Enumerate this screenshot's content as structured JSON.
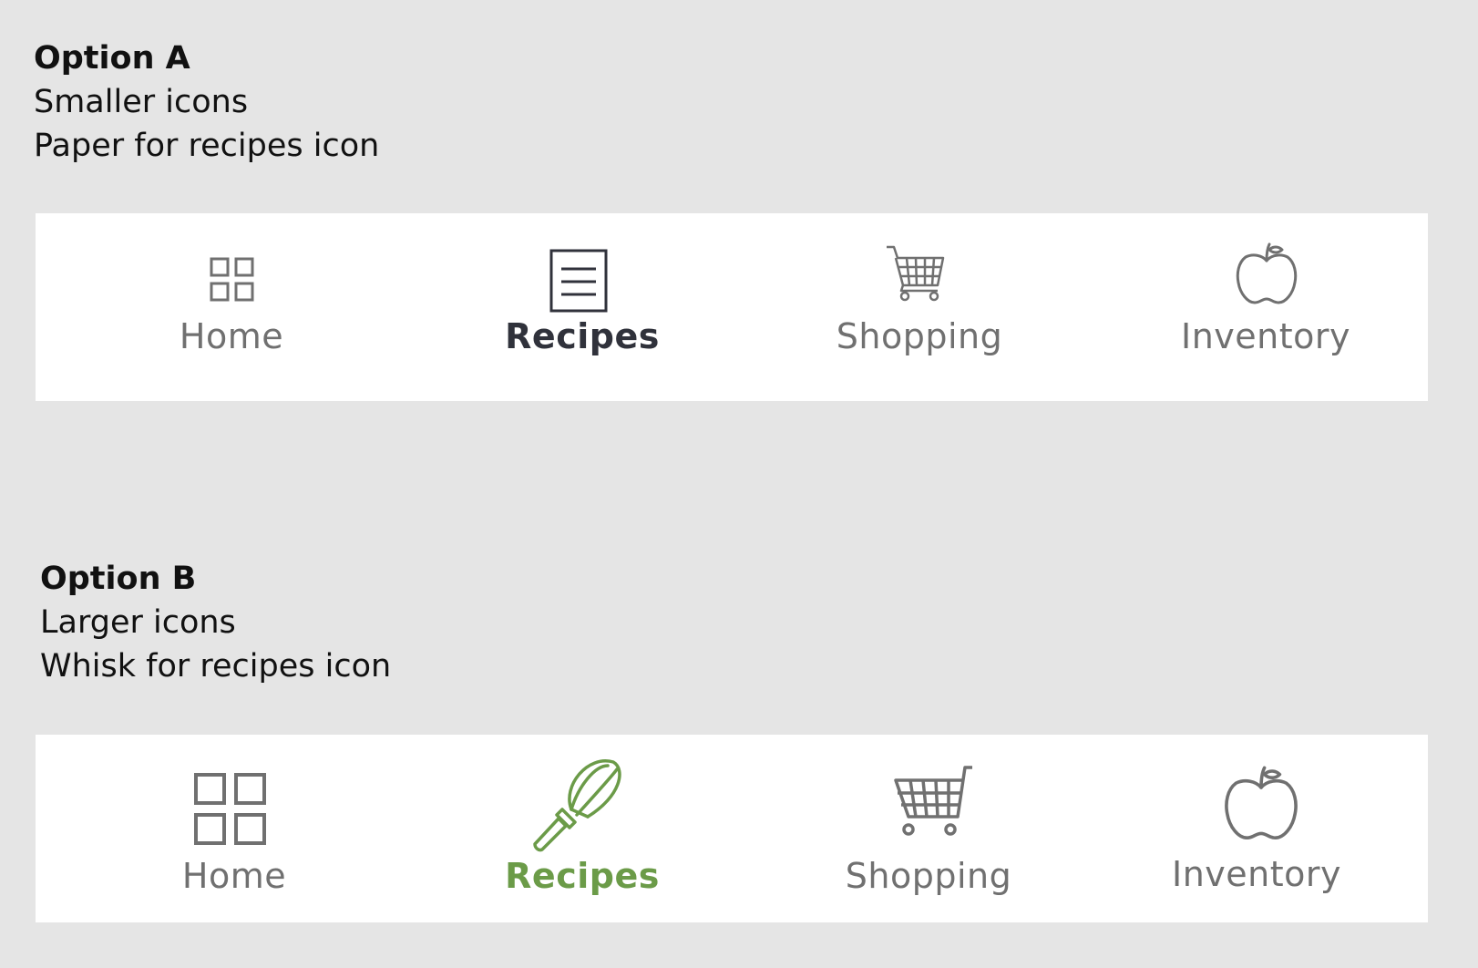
{
  "option_a": {
    "title": "Option A",
    "line1": "Smaller icons",
    "line2": "Paper for recipes icon",
    "nav": [
      {
        "label": "Home",
        "icon": "grid-icon",
        "active": false
      },
      {
        "label": "Recipes",
        "icon": "document-icon",
        "active": true
      },
      {
        "label": "Shopping",
        "icon": "shopping-cart-icon",
        "active": false
      },
      {
        "label": "Inventory",
        "icon": "apple-icon",
        "active": false
      }
    ]
  },
  "option_b": {
    "title": "Option B",
    "line1": "Larger icons",
    "line2": "Whisk for recipes icon",
    "nav": [
      {
        "label": "Home",
        "icon": "grid-icon",
        "active": false
      },
      {
        "label": "Recipes",
        "icon": "whisk-icon",
        "active": true
      },
      {
        "label": "Shopping",
        "icon": "shopping-cart-icon",
        "active": false
      },
      {
        "label": "Inventory",
        "icon": "apple-icon",
        "active": false
      }
    ]
  },
  "colors": {
    "background": "#e5e5e5",
    "navbar": "#ffffff",
    "inactive": "#707070",
    "active_dark": "#30323b",
    "active_green": "#6b9b48"
  }
}
